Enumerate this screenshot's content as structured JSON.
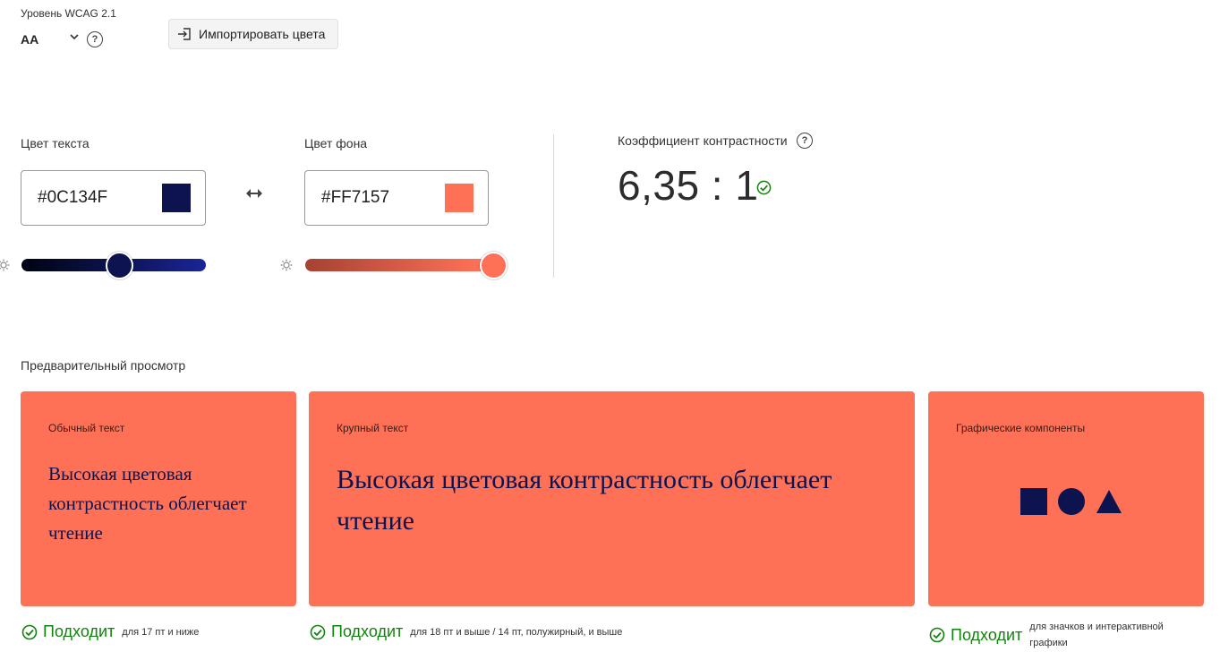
{
  "wcag": {
    "label": "Уровень WCAG 2.1",
    "value": "AA",
    "help_icon": "?"
  },
  "import_button": {
    "label": "Импортировать цвета",
    "icon": "import-icon"
  },
  "text_color": {
    "label": "Цвет текста",
    "hex": "#0C134F",
    "swatch": "#0C134F",
    "brightness_fraction": 0.5
  },
  "background_color": {
    "label": "Цвет фона",
    "hex": "#FF7157",
    "swatch": "#FF7157",
    "brightness_fraction": 1.0
  },
  "contrast": {
    "label": "Коэффициент контрастности",
    "ratio": "6,35 : 1",
    "help_icon": "?"
  },
  "preview": {
    "label": "Предварительный просмотр",
    "cards": [
      {
        "title": "Обычный текст",
        "sample": "Высокая цветовая контрастность облегчает чтение",
        "result": "Подходит",
        "note": "для 17 пт и ниже"
      },
      {
        "title": "Крупный текст",
        "sample": "Высокая цветовая контрастность облегчает чтение",
        "result": "Подходит",
        "note": "для 18 пт и выше / 14 пт, полужирный, и выше"
      },
      {
        "title": "Графические компоненты",
        "result": "Подходит",
        "note": "для значков и интерактивной графики"
      }
    ]
  },
  "colors": {
    "pass_green": "#12820E",
    "text_color": "#0C134F",
    "background_color": "#FF7157"
  }
}
